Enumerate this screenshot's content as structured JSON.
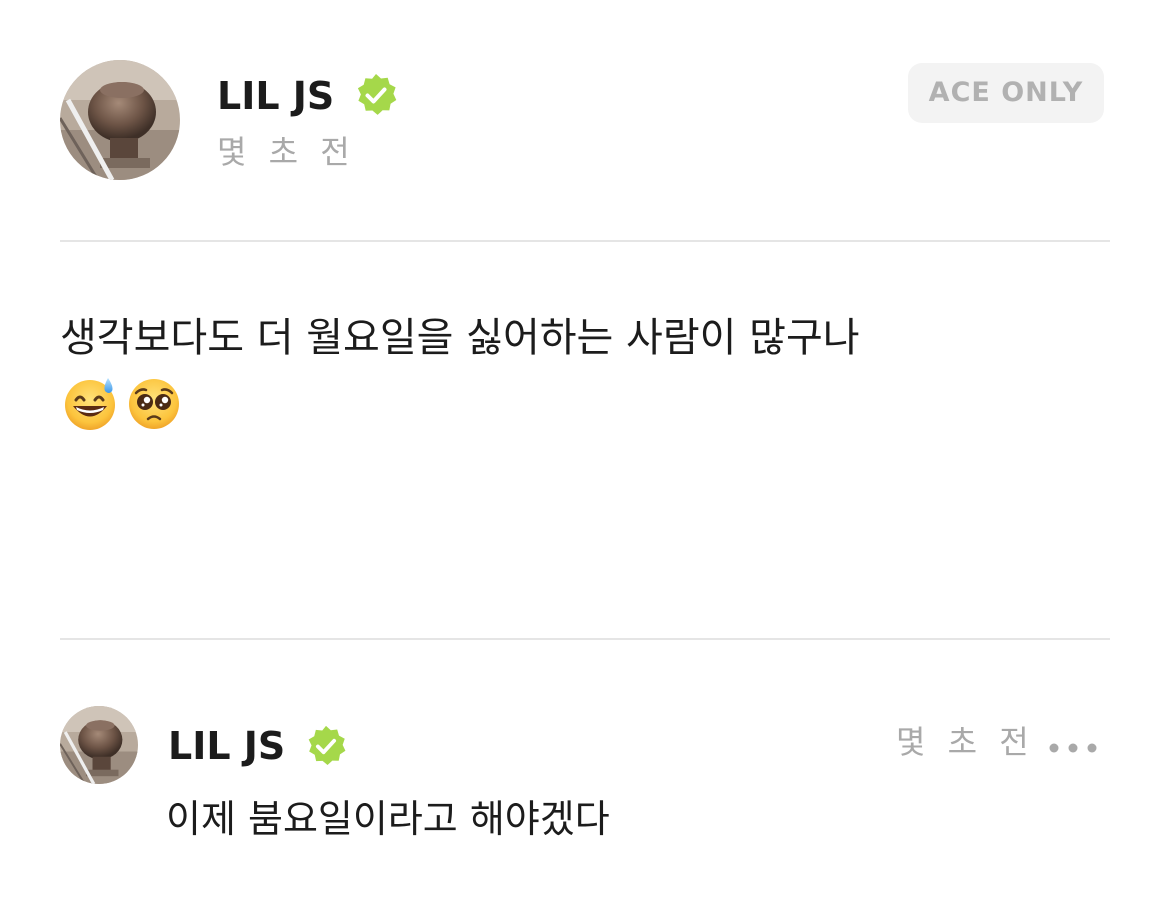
{
  "post": {
    "author": {
      "name": "LIL JS",
      "verified": true,
      "avatar": "avatar-photo"
    },
    "timestamp": "몇 초 전",
    "badge": "ACE ONLY",
    "text": "생각보다도 더 월요일을 싫어하는 사람이 많구나",
    "emojis": [
      "grinning-face-with-sweat",
      "pleading-face"
    ]
  },
  "comment": {
    "author": {
      "name": "LIL JS",
      "verified": true,
      "avatar": "avatar-photo"
    },
    "timestamp": "몇 초 전",
    "text": "이제 붐요일이라고 해야겠다",
    "more_icon": "more-horizontal-icon"
  },
  "colors": {
    "verified_badge": "#a5d84a",
    "badge_bg": "#f3f3f3",
    "badge_text": "#b1b1b1",
    "muted_text": "#a9a9a9",
    "divider": "#e5e5e5",
    "text": "#1c1c1c"
  }
}
